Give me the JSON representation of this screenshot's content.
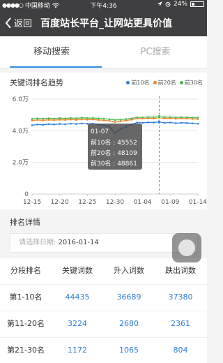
{
  "status_bar": {
    "carrier": "中国移动",
    "time": "下午4:36",
    "battery_percent": "24%",
    "battery_level": 0.24
  },
  "navbar": {
    "back_label": "返回",
    "title": "百度站长平台_让网站更具价值"
  },
  "tabs": [
    {
      "label": "移动搜索",
      "active": true
    },
    {
      "label": "PC搜索",
      "active": false
    }
  ],
  "chart_section": {
    "title": "关键词排名趋势"
  },
  "chart_data": {
    "type": "line",
    "title": "关键词排名趋势",
    "xlabel": "",
    "ylabel": "",
    "x_tick_labels": [
      "12-15",
      "12-20",
      "12-25",
      "12-30",
      "01-04",
      "01-09",
      "01-14"
    ],
    "y_tick_labels": [
      "0",
      "2.0万",
      "4.0万",
      "6.0万"
    ],
    "ylim": [
      0,
      60000
    ],
    "grid": true,
    "legend_position": "top-right",
    "x": [
      "12-15",
      "12-16",
      "12-17",
      "12-18",
      "12-19",
      "12-20",
      "12-21",
      "12-22",
      "12-23",
      "12-24",
      "12-25",
      "12-26",
      "12-27",
      "12-28",
      "12-29",
      "12-30",
      "12-31",
      "01-01",
      "01-02",
      "01-03",
      "01-04",
      "01-05",
      "01-06",
      "01-07",
      "01-08",
      "01-09",
      "01-10",
      "01-11",
      "01-12",
      "01-13",
      "01-14"
    ],
    "series": [
      {
        "name": "前10名",
        "color": "#2f7fd8",
        "values": [
          43500,
          44000,
          43800,
          44200,
          44000,
          44300,
          44100,
          44500,
          44300,
          44600,
          44400,
          44500,
          44000,
          43500,
          42500,
          38500,
          41000,
          42500,
          44000,
          45200,
          45000,
          45300,
          45200,
          45552,
          45000,
          45200,
          44800,
          45000,
          44900,
          44700,
          44500
        ]
      },
      {
        "name": "前20名",
        "color": "#f0842c",
        "values": [
          46500,
          46800,
          46600,
          46900,
          46700,
          47000,
          46800,
          47100,
          46900,
          47200,
          47000,
          47100,
          46800,
          46600,
          46300,
          45500,
          46000,
          46500,
          47000,
          47800,
          47700,
          47900,
          47800,
          48109,
          47800,
          47900,
          47600,
          47800,
          47700,
          47500,
          47400
        ]
      },
      {
        "name": "前30名",
        "color": "#4cba4c",
        "values": [
          47500,
          47800,
          47600,
          47900,
          47700,
          48000,
          47800,
          48100,
          47900,
          48200,
          48000,
          48100,
          47800,
          47600,
          47300,
          46800,
          47000,
          47400,
          47800,
          48500,
          48500,
          48700,
          48600,
          48861,
          48600,
          48700,
          48400,
          48600,
          48500,
          48300,
          48200
        ]
      }
    ],
    "tooltip": {
      "date": "01-07",
      "lines": [
        "前10名 : 45552",
        "前20名 : 48109",
        "前30名 : 48861"
      ]
    }
  },
  "details": {
    "title": "排名详情",
    "date_placeholder": "请选择日期:",
    "date_value": "2016-01-14"
  },
  "table": {
    "headers": [
      "分段排名",
      "关键词数",
      "升入词数",
      "跌出词数"
    ],
    "rows": [
      [
        "第1-10名",
        "44435",
        "36689",
        "37380"
      ],
      [
        "第11-20名",
        "3224",
        "2680",
        "2361"
      ],
      [
        "第21-30名",
        "1172",
        "1065",
        "804"
      ]
    ]
  }
}
